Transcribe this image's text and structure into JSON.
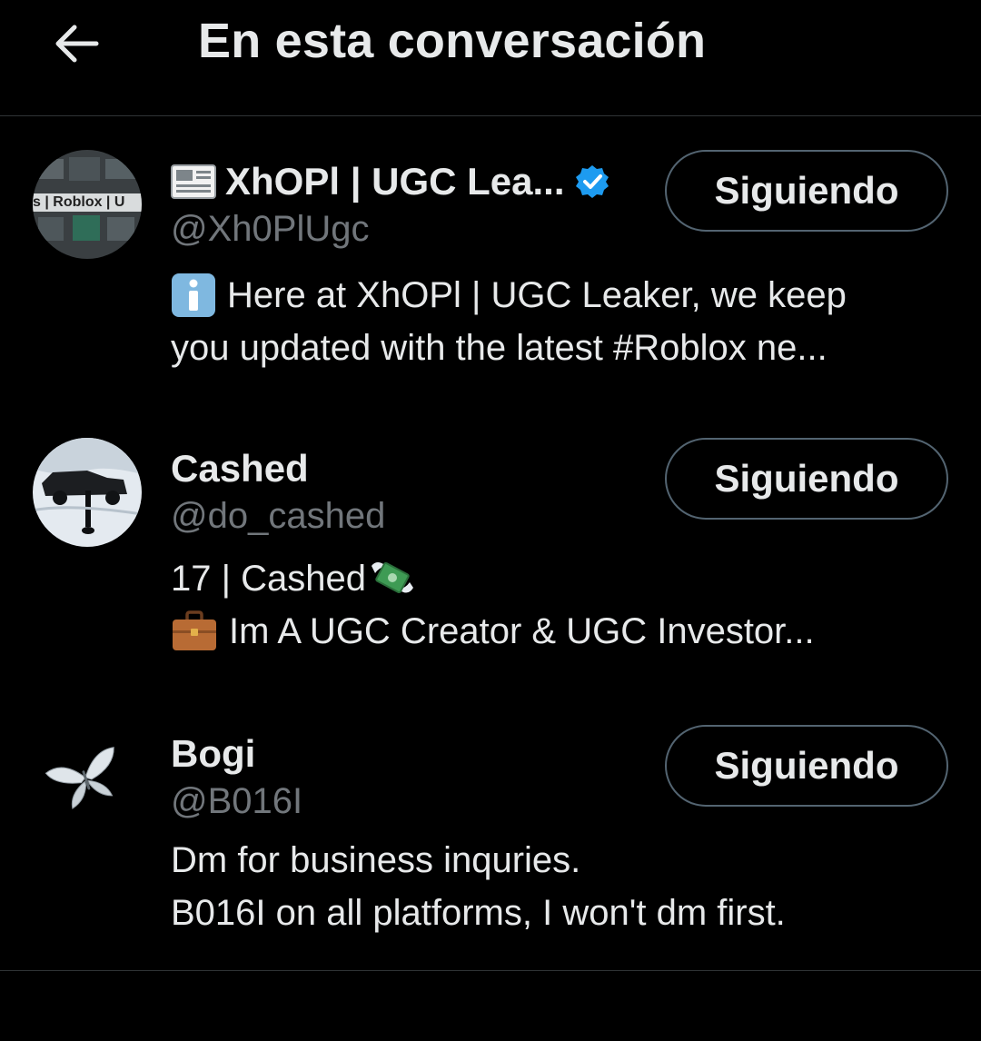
{
  "header": {
    "back_icon": "arrow-left-icon",
    "title": "En esta conversación"
  },
  "users": [
    {
      "display_name": "XhOPl | UGC Lea...",
      "name_prefix_icon": "newspaper-icon",
      "verified": true,
      "verified_color": "#1d9bf0",
      "handle": "@Xh0PlUgc",
      "bio_lines": [
        {
          "icon": "information-icon",
          "text": "Here at XhOPl | UGC Leaker, we keep"
        },
        {
          "icon": "",
          "text": "you updated with the latest #Roblox ne..."
        }
      ],
      "avatar_text": "s | Roblox | U",
      "follow_label": "Siguiendo"
    },
    {
      "display_name": "Cashed",
      "handle": "@do_cashed",
      "bio_lines": [
        {
          "text": "17 | Cashed",
          "suffix_icon": "money-with-wings-icon"
        },
        {
          "icon": "briefcase-icon",
          "text": "Im A UGC Creator & UGC Investor..."
        }
      ],
      "follow_label": "Siguiendo"
    },
    {
      "display_name": "Bogi",
      "handle": "@B016I",
      "bio_lines": [
        {
          "text": "Dm for business inquries."
        },
        {
          "text": "B016I on all platforms, I won't dm first."
        }
      ],
      "follow_label": "Siguiendo"
    }
  ],
  "colors": {
    "background": "#000000",
    "text_primary": "#e7e9ea",
    "text_secondary": "#71767b",
    "divider": "#2f3336",
    "button_border": "#536471"
  }
}
